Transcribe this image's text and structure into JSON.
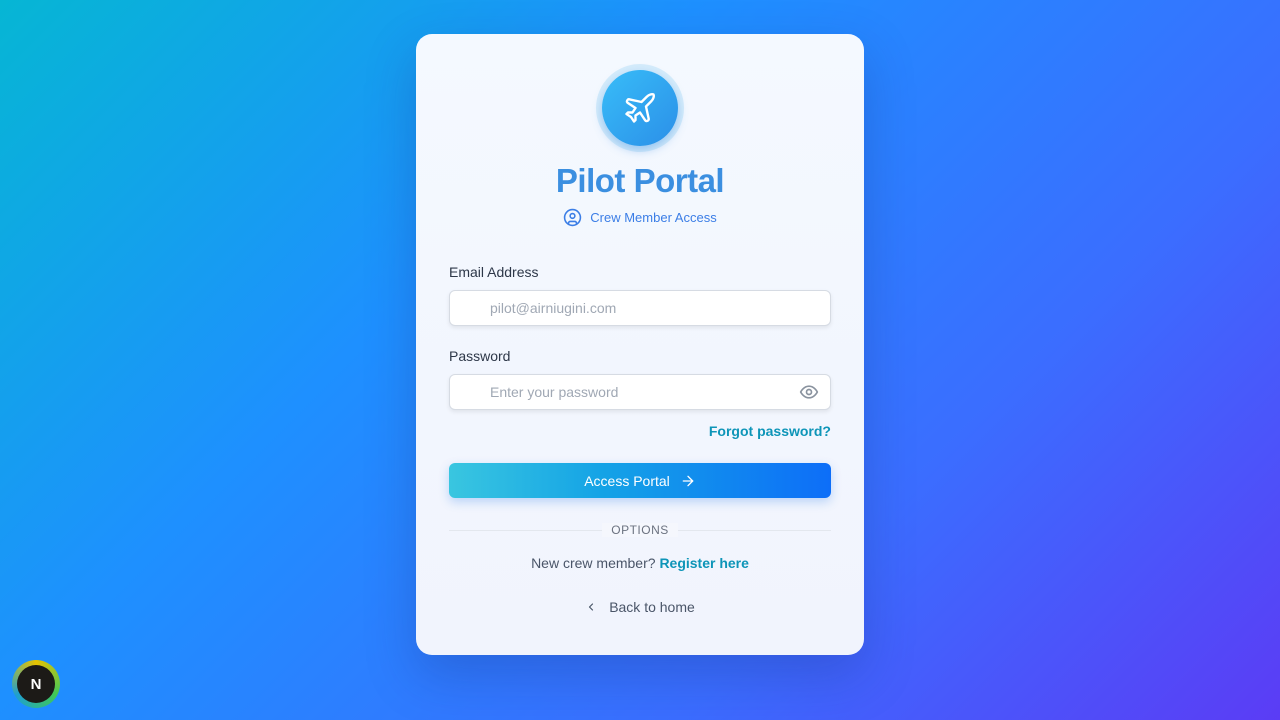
{
  "brand": {
    "title": "Pilot Portal",
    "subtitle": "Crew Member Access",
    "logo_icon": "airplane-icon",
    "subtitle_icon": "user-circle-icon"
  },
  "form": {
    "email_label": "Email Address",
    "email_placeholder": "pilot@airniugini.com",
    "email_value": "",
    "password_label": "Password",
    "password_placeholder": "Enter your password",
    "password_value": "",
    "forgot_link": "Forgot password?",
    "submit_label": "Access Portal",
    "submit_icon": "arrow-right-icon"
  },
  "options": {
    "divider_text": "OPTIONS",
    "register_prompt": "New crew member?",
    "register_link": "Register here",
    "back_label": "Back to home",
    "back_icon": "chevron-left-icon"
  },
  "badge": {
    "letter": "N"
  },
  "colors": {
    "accent": "#3b8fe0",
    "link": "#0e95b8",
    "button_start": "#39c6e0",
    "button_end": "#0d6ef8"
  }
}
